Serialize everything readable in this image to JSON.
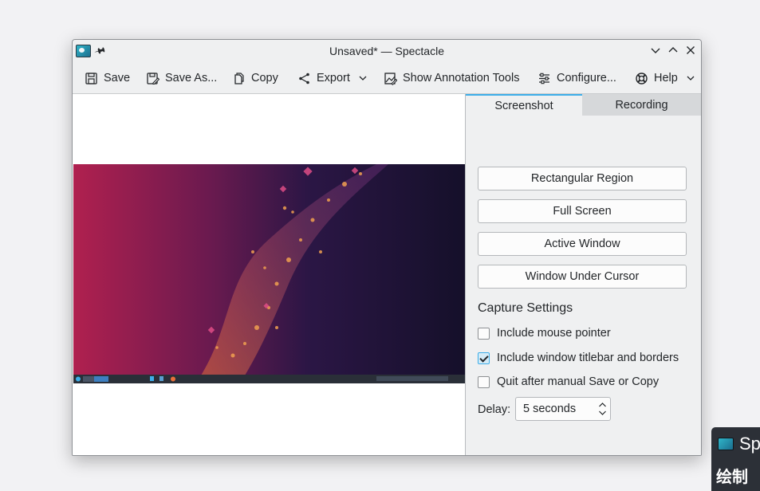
{
  "window": {
    "title": "Unsaved* — Spectacle"
  },
  "toolbar": {
    "save": "Save",
    "save_as": "Save As...",
    "copy": "Copy",
    "export": "Export",
    "annotation": "Show Annotation Tools",
    "configure": "Configure...",
    "help": "Help"
  },
  "tabs": {
    "screenshot": "Screenshot",
    "recording": "Recording"
  },
  "capture_modes": [
    "Rectangular Region",
    "Full Screen",
    "Active Window",
    "Window Under Cursor"
  ],
  "settings": {
    "heading": "Capture Settings",
    "options": [
      {
        "label": "Include mouse pointer",
        "checked": false
      },
      {
        "label": "Include window titlebar and borders",
        "checked": true
      },
      {
        "label": "Quit after manual Save or Copy",
        "checked": false
      }
    ],
    "delay_label": "Delay:",
    "delay_value": "5 seconds"
  },
  "background_window": {
    "title": "Sp",
    "text": "绘制"
  },
  "colors": {
    "accent": "#3daee9",
    "window_bg": "#eff0f1",
    "wallpaper_left": "#b0204f",
    "wallpaper_right": "#15102a"
  }
}
